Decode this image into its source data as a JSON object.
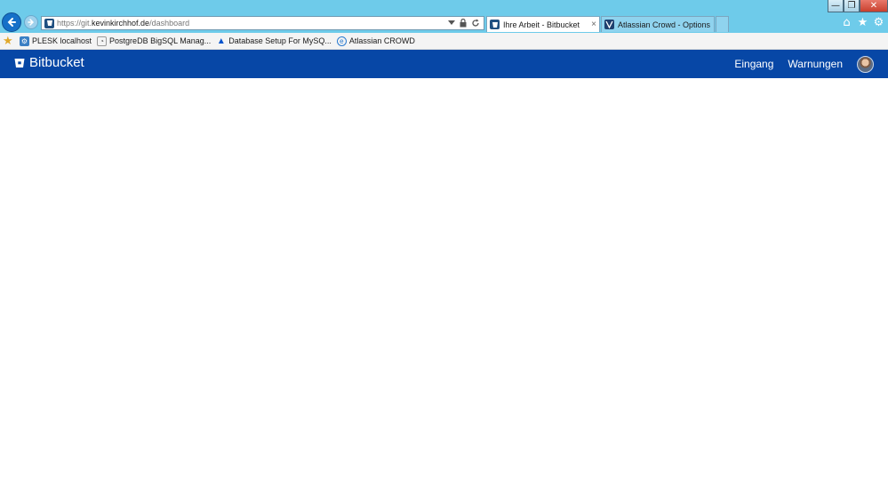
{
  "browser": {
    "address_url_prefix": "https://git.",
    "address_url_host": "kevinkirchhof.de",
    "address_url_path": "/dashboard",
    "tabs": [
      {
        "label": "Ihre Arbeit - Bitbucket",
        "active": true
      },
      {
        "label": "Atlassian Crowd - Options",
        "active": false
      }
    ],
    "window_controls": {
      "minimize": "—",
      "restore": "❐",
      "close": "✕"
    }
  },
  "favorites": [
    {
      "label": "PLESK localhost",
      "icon": "plesk-icon"
    },
    {
      "label": "PostgreDB BigSQL Manag...",
      "icon": "postgres-icon"
    },
    {
      "label": "Database Setup For MySQ...",
      "icon": "atlassian-icon"
    },
    {
      "label": "Atlassian CROWD",
      "icon": "ie-page-icon"
    }
  ],
  "bitbucket": {
    "brand": "Bitbucket",
    "nav": {
      "inbox": "Eingang",
      "warnings": "Warnungen"
    }
  },
  "colors": {
    "ie_chrome": "#6ecbea",
    "bitbucket_header": "#0747a6",
    "page_background": "#ffffff"
  }
}
